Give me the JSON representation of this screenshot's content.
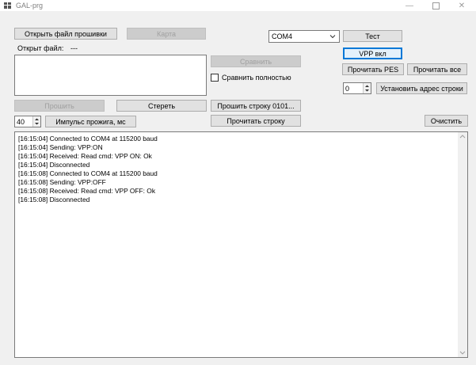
{
  "window": {
    "title": "GAL-prg"
  },
  "buttons": {
    "open_firmware": "Открыть файл прошивки",
    "map": "Карта",
    "test": "Тест",
    "vpp_on": "VPP вкл",
    "compare": "Сравнить",
    "read_pes": "Прочитать PES",
    "read_all": "Прочитать все",
    "set_row_address": "Установить адрес строки",
    "program": "Прошить",
    "erase": "Стереть",
    "program_row": "Прошить строку 0101...",
    "read_row": "Прочитать строку",
    "pulse_width": "Импульс прожига, мс",
    "clear": "Очистить"
  },
  "labels": {
    "open_file": "Открыт файл:",
    "open_file_value": "---",
    "compare_fully": "Сравнить полностью"
  },
  "port_select": {
    "value": "COM4"
  },
  "row_address": {
    "value": "0"
  },
  "pulse_ms": {
    "value": "40"
  },
  "log": [
    "[16:15:04] Connected to COM4 at 115200 baud",
    "[16:15:04] Sending: VPP:ON",
    "[16:15:04] Received: Read cmd:  VPP ON: Ok",
    "[16:15:04] Disconnected",
    "[16:15:08] Connected to COM4 at 115200 baud",
    "[16:15:08] Sending: VPP:OFF",
    "[16:15:08] Received: Read cmd:  VPP OFF: Ok",
    "[16:15:08] Disconnected"
  ],
  "colors": {
    "focus_border": "#0078d7",
    "window_bg": "#f0f0f0"
  }
}
